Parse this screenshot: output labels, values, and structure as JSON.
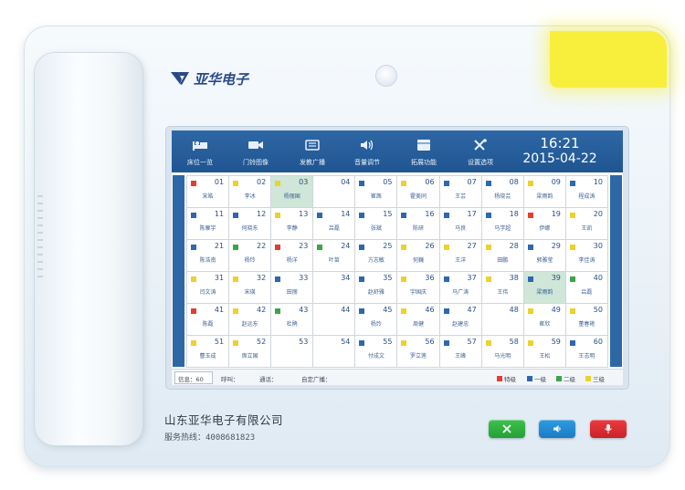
{
  "brand": {
    "name": "亚华电子"
  },
  "menu": [
    {
      "label": "床位一览",
      "icon": "bed-icon"
    },
    {
      "label": "门铃图像",
      "icon": "camera-icon"
    },
    {
      "label": "发教广播",
      "icon": "broadcast-icon"
    },
    {
      "label": "音量调节",
      "icon": "volume-icon"
    },
    {
      "label": "拓展功能",
      "icon": "extension-icon"
    },
    {
      "label": "设置选项",
      "icon": "settings-icon"
    }
  ],
  "clock": {
    "time": "16:21",
    "date": "2015-04-22"
  },
  "colors": {
    "special": "#e43d30",
    "level1": "#2e67b1",
    "level2": "#3aa648",
    "level3": "#eed12a",
    "highlight": "#cfe6d8",
    "topbar": "#2e67a5"
  },
  "beds": [
    {
      "num": "01",
      "name": "宋皓",
      "level": "special"
    },
    {
      "num": "02",
      "name": "李冰",
      "level": "level3"
    },
    {
      "num": "03",
      "name": "杨丽国",
      "level": "level3",
      "highlight": true
    },
    {
      "num": "04",
      "name": "",
      "level": ""
    },
    {
      "num": "05",
      "name": "崔茜",
      "level": "level1"
    },
    {
      "num": "06",
      "name": "霍美同",
      "level": "level3"
    },
    {
      "num": "07",
      "name": "王芸",
      "level": "level1"
    },
    {
      "num": "08",
      "name": "杨晓芸",
      "level": "level1"
    },
    {
      "num": "09",
      "name": "梁雨韵",
      "level": "level3"
    },
    {
      "num": "10",
      "name": "程成涛",
      "level": "level1"
    },
    {
      "num": "11",
      "name": "陈雁宇",
      "level": "level1"
    },
    {
      "num": "12",
      "name": "何晓东",
      "level": "level1"
    },
    {
      "num": "13",
      "name": "李静",
      "level": "level3"
    },
    {
      "num": "14",
      "name": "吕磊",
      "level": "level1"
    },
    {
      "num": "15",
      "name": "张斌",
      "level": "level1"
    },
    {
      "num": "16",
      "name": "陈研",
      "level": "level1"
    },
    {
      "num": "17",
      "name": "马良",
      "level": "level1"
    },
    {
      "num": "18",
      "name": "马学超",
      "level": "level1"
    },
    {
      "num": "19",
      "name": "伊娜",
      "level": "special"
    },
    {
      "num": "20",
      "name": "王凯",
      "level": "level3"
    },
    {
      "num": "21",
      "name": "陈浩南",
      "level": "level1"
    },
    {
      "num": "22",
      "name": "杨玲",
      "level": "level2"
    },
    {
      "num": "23",
      "name": "杨洋",
      "level": "special"
    },
    {
      "num": "24",
      "name": "叶苗",
      "level": "level2"
    },
    {
      "num": "25",
      "name": "方志敏",
      "level": "level1"
    },
    {
      "num": "26",
      "name": "何巍",
      "level": "level3"
    },
    {
      "num": "27",
      "name": "王洋",
      "level": "level3"
    },
    {
      "num": "28",
      "name": "田鹏",
      "level": "level3"
    },
    {
      "num": "29",
      "name": "郭雅莹",
      "level": "level1"
    },
    {
      "num": "30",
      "name": "李佳涛",
      "level": "level3"
    },
    {
      "num": "31",
      "name": "闫文涛",
      "level": "level3"
    },
    {
      "num": "32",
      "name": "宋瑛",
      "level": "level3"
    },
    {
      "num": "33",
      "name": "田丽",
      "level": "level1"
    },
    {
      "num": "34",
      "name": "",
      "level": ""
    },
    {
      "num": "35",
      "name": "赵舒雅",
      "level": "level1"
    },
    {
      "num": "36",
      "name": "宇国庆",
      "level": "level3"
    },
    {
      "num": "37",
      "name": "马广涛",
      "level": "level1"
    },
    {
      "num": "38",
      "name": "王伟",
      "level": "level3"
    },
    {
      "num": "39",
      "name": "梁雨韵",
      "level": "level1",
      "highlight": true
    },
    {
      "num": "40",
      "name": "吕磊",
      "level": "level2"
    },
    {
      "num": "41",
      "name": "陈磊",
      "level": "special"
    },
    {
      "num": "42",
      "name": "赵远东",
      "level": "level3"
    },
    {
      "num": "43",
      "name": "杜鹃",
      "level": "level2"
    },
    {
      "num": "44",
      "name": "",
      "level": ""
    },
    {
      "num": "45",
      "name": "杨玲",
      "level": "level1"
    },
    {
      "num": "46",
      "name": "周健",
      "level": "level3"
    },
    {
      "num": "47",
      "name": "赵建忠",
      "level": "level1"
    },
    {
      "num": "48",
      "name": "",
      "level": ""
    },
    {
      "num": "49",
      "name": "崔欣",
      "level": "level3"
    },
    {
      "num": "50",
      "name": "董春艳",
      "level": "level3"
    },
    {
      "num": "51",
      "name": "曹玉成",
      "level": "level3"
    },
    {
      "num": "52",
      "name": "席立国",
      "level": "level3"
    },
    {
      "num": "53",
      "name": "",
      "level": ""
    },
    {
      "num": "54",
      "name": "",
      "level": ""
    },
    {
      "num": "55",
      "name": "付成文",
      "level": "level1"
    },
    {
      "num": "56",
      "name": "罗立莲",
      "level": "level3"
    },
    {
      "num": "57",
      "name": "王峰",
      "level": "level1"
    },
    {
      "num": "58",
      "name": "马光明",
      "level": "level3"
    },
    {
      "num": "59",
      "name": "王松",
      "level": "level3"
    },
    {
      "num": "60",
      "name": "王志明",
      "level": "level1"
    }
  ],
  "status": {
    "beds_label": "信息：60",
    "call_label": "呼叫：",
    "tonghua_label": "通话：",
    "broadcast_label": "自定广播："
  },
  "legend": [
    {
      "label": "特级",
      "color": "#e43d30"
    },
    {
      "label": "一级",
      "color": "#2e67b1"
    },
    {
      "label": "二级",
      "color": "#3aa648"
    },
    {
      "label": "三级",
      "color": "#eed12a"
    }
  ],
  "company": {
    "name": "山东亚华电子有限公司",
    "hotline": "服务热线：4008681823"
  },
  "buttons": [
    {
      "name": "hangup-button",
      "icon": "close-icon"
    },
    {
      "name": "speaker-button",
      "icon": "speaker-icon"
    },
    {
      "name": "mic-button",
      "icon": "microphone-icon"
    }
  ]
}
